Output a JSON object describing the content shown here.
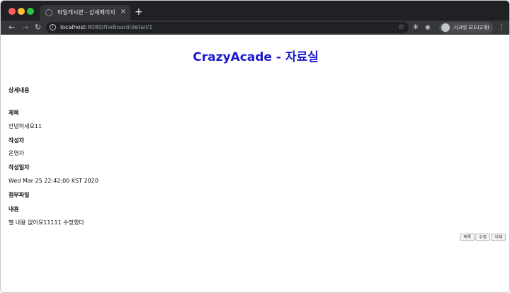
{
  "browser": {
    "tab": {
      "title": "파일게시판 - 상세페이지",
      "close": "×"
    },
    "new_tab": "+",
    "url_host": "localhost",
    "url_path": ":8080/fileBoard/detail/1",
    "incognito_label": "시크릿 모드(2개)"
  },
  "page": {
    "title": "CrazyAcade - 자료실",
    "section_heading": "상세내용",
    "fields": {
      "subject_label": "제목",
      "subject_value": "안녕하세요11",
      "writer_label": "작성자",
      "writer_value": "운영자",
      "date_label": "작성일자",
      "date_value": "Wed Mar 25 22:42:00 KST 2020",
      "attachment_label": "첨부파일",
      "content_label": "내용",
      "content_value": "별 내용 없어요11111 수정했다"
    },
    "buttons": {
      "list": "목록",
      "edit": "수정",
      "delete": "삭제"
    }
  },
  "icons": {
    "back": "back-arrow-icon",
    "forward": "forward-arrow-icon",
    "reload": "reload-icon",
    "info": "info-icon",
    "star": "star-icon",
    "menu": "kebab-menu-icon"
  },
  "colors": {
    "title": "#1a1acc",
    "chrome_dark": "#202124",
    "chrome_toolbar": "#35363a"
  }
}
